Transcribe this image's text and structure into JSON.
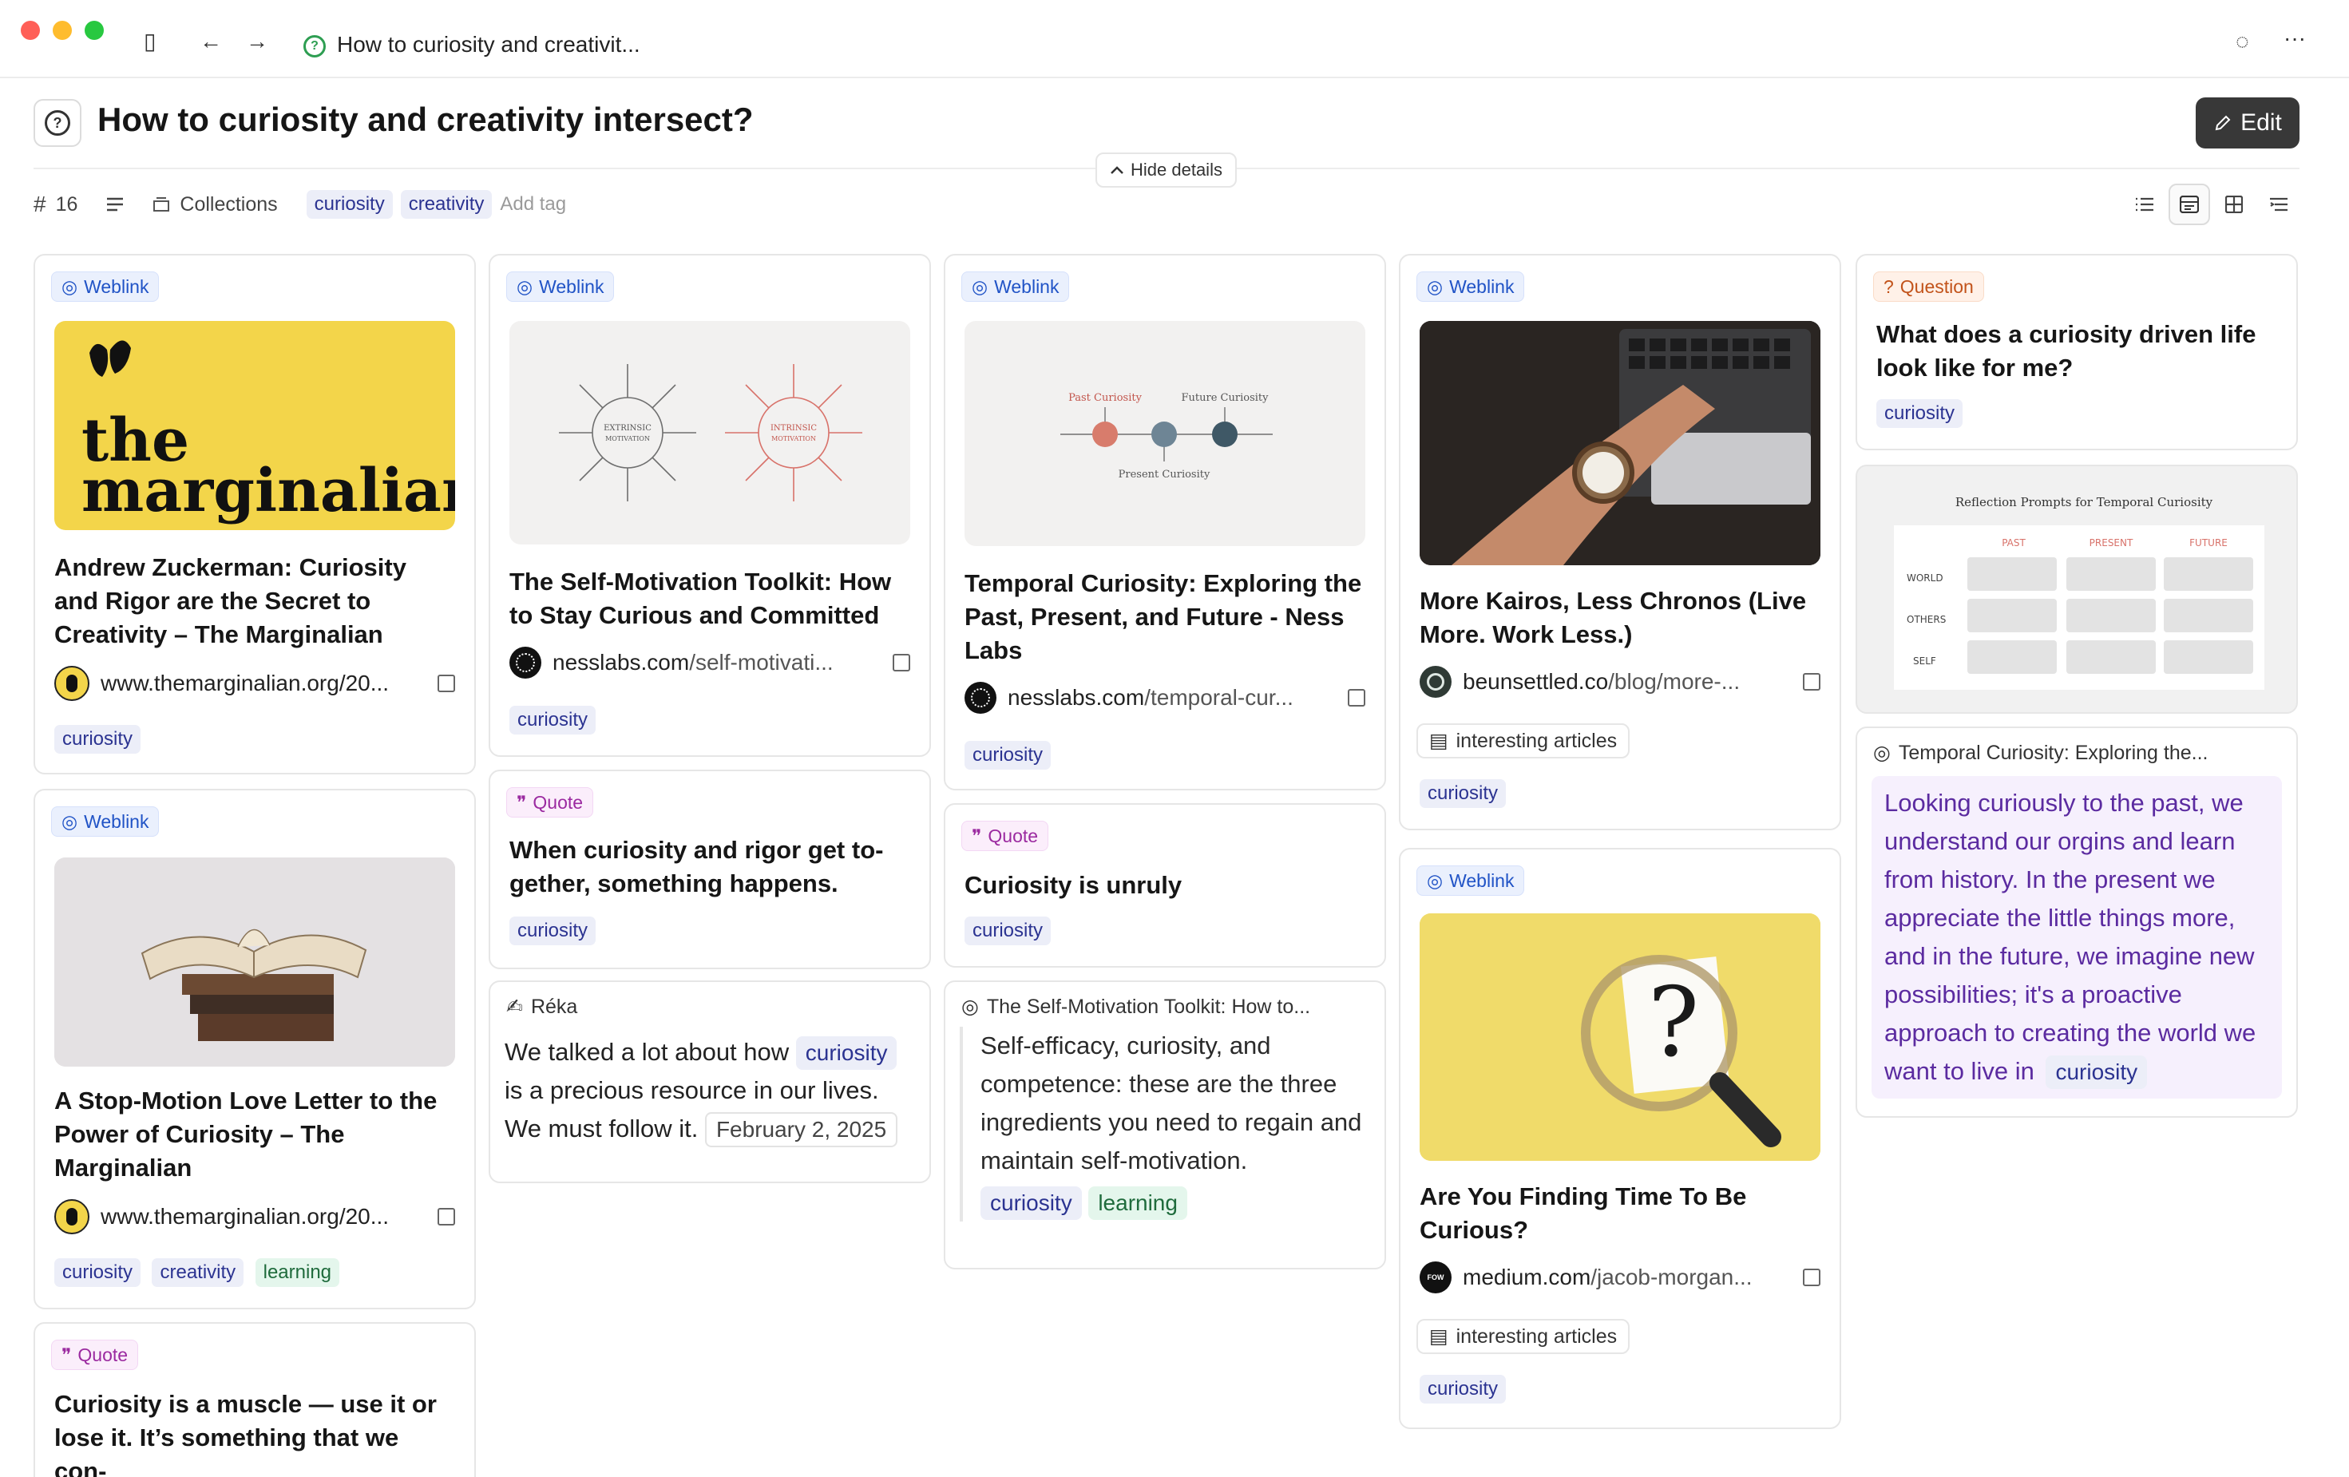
{
  "window": {
    "tab_title": "How to curiosity and creativit...",
    "buttons": {
      "sidebar": "▯",
      "back": "←",
      "forward": "→",
      "spinner": "◌",
      "more": "···"
    }
  },
  "header": {
    "title": "How to curiosity and creativity intersect?",
    "edit_label": "Edit",
    "hide_details_label": "Hide details"
  },
  "toolbar": {
    "count": "16",
    "collections_label": "Collections",
    "tags": [
      "curiosity",
      "creativity"
    ],
    "add_tag_placeholder": "Add tag"
  },
  "cards": {
    "c1": {
      "type": "Weblink",
      "thumb_text": [
        "the",
        "marginalian"
      ],
      "title": "Andrew Zuckerman: Curiosity and Rigor are the Secret to Creativity – The Marginalian",
      "url": "www.themarginalian.org/20...",
      "tags": [
        "curiosity"
      ]
    },
    "c2": {
      "type": "Weblink",
      "title": "A Stop-Motion Love Letter to the Power of Curiosity – The Marginalian",
      "url": "www.themarginalian.org/20...",
      "tags": [
        "curiosity",
        "creativity",
        "learning"
      ]
    },
    "c3": {
      "type": "Quote",
      "title": "Curiosity is a muscle — use it or lose it. It’s something that we con-"
    },
    "c4": {
      "type": "Weblink",
      "thumb_labels": [
        "EXTRINSIC",
        "MOTIVATION",
        "INTRINSIC",
        "MOTIVATION"
      ],
      "title": "The Self-Motivation Toolkit: How to Stay Curious and Committed",
      "url_main": "nesslabs.com",
      "url_path": "/self-motivati...",
      "tags": [
        "curiosity"
      ]
    },
    "c5": {
      "type": "Quote",
      "title": "When curiosity and rigor get to-gether, something happens.",
      "tags": [
        "curiosity"
      ]
    },
    "c6": {
      "author": "Réka",
      "text_before": "We talked a lot about how",
      "inline_tag": "curiosity",
      "text_after": "is a precious resource in our lives. We must follow it.",
      "date": "February 2, 2025"
    },
    "c7": {
      "type": "Weblink",
      "thumb_labels": [
        "Past Curiosity",
        "Future Curiosity",
        "Present Curiosity"
      ],
      "title": "Temporal Curiosity: Exploring the Past, Present, and Future - Ness Labs",
      "url_main": "nesslabs.com",
      "url_path": "/temporal-cur...",
      "tags": [
        "curiosity"
      ]
    },
    "c8": {
      "type": "Quote",
      "title": "Curiosity is unruly",
      "tags": [
        "curiosity"
      ]
    },
    "c9": {
      "source": "The Self-Motivation Toolkit: How to...",
      "text": "Self-efficacy, curiosity, and competence: these are the three ingredients you need to regain and maintain self-motivation.",
      "tags": [
        "curiosity",
        "learning"
      ]
    },
    "c10": {
      "type": "Weblink",
      "title": "More Kairos, Less Chronos (Live More. Work Less.)",
      "url_main": "beunsettled.co",
      "url_path": "/blog/more-...",
      "collection": "interesting articles",
      "tags": [
        "curiosity"
      ]
    },
    "c11": {
      "type": "Weblink",
      "title": "Are You Finding Time To Be Curious?",
      "url_main": "medium.com",
      "url_path": "/jacob-morgan...",
      "collection": "interesting articles",
      "tags": [
        "curiosity"
      ]
    },
    "c12": {
      "type": "Question",
      "title": "What does a curiosity driven life look like for me?",
      "tags": [
        "curiosity"
      ]
    },
    "c13": {
      "image_title": "Reflection Prompts for Temporal Curiosity",
      "cols": [
        "PAST",
        "PRESENT",
        "FUTURE"
      ],
      "rows": [
        "WORLD",
        "OTHERS",
        "SELF"
      ]
    },
    "c14": {
      "source": "Temporal Curiosity: Exploring the...",
      "text": "Looking curiously to the past, we understand our orgins and learn from history. In the present we appreciate the little things more, and in the future, we imagine new possibilities; it's a proactive approach to creating the world we want to live in",
      "inline_tag": "curiosity"
    }
  },
  "colors": {
    "accent_dark": "#383838",
    "tag_bg": "#eceef8",
    "tag_fg": "#2b3391",
    "learning_bg": "#e4f6ec",
    "weblink": "#2053c6",
    "quote": "#9b2aa0",
    "question": "#c2531a",
    "highlight_purple": "#5b2ba0"
  }
}
